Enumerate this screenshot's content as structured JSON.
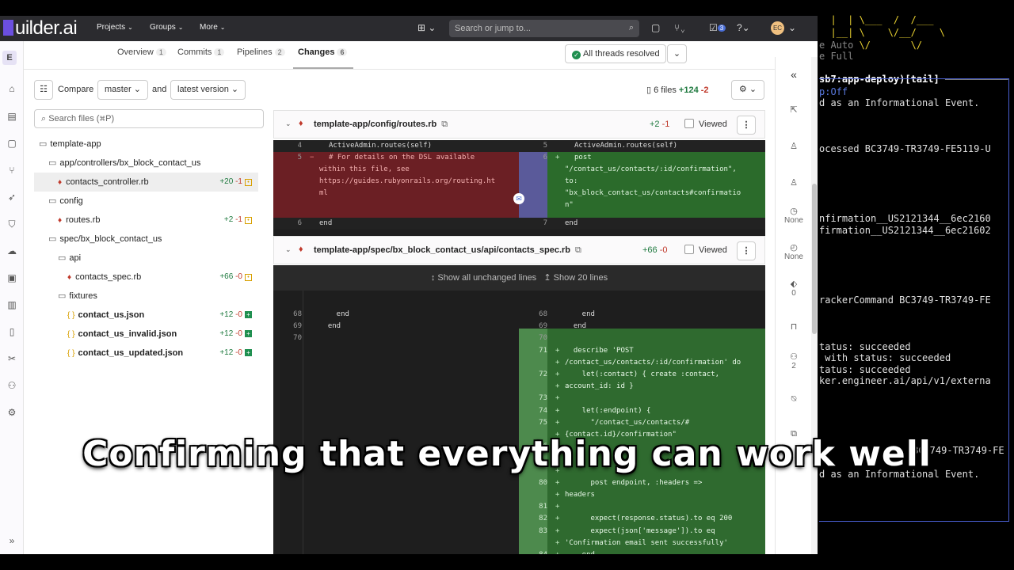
{
  "header": {
    "logo": "uilder.ai",
    "nav": [
      "Projects",
      "Groups",
      "More"
    ],
    "search_placeholder": "Search or jump to...",
    "todo_count": "3",
    "avatar_initials": "EC"
  },
  "tabs": [
    {
      "label": "Overview",
      "count": "1"
    },
    {
      "label": "Commits",
      "count": "1"
    },
    {
      "label": "Pipelines",
      "count": "2"
    },
    {
      "label": "Changes",
      "count": "6"
    }
  ],
  "threads_resolved": "All threads resolved",
  "compare": {
    "label": "Compare",
    "source": "master",
    "and": "and",
    "target": "latest version"
  },
  "summary": {
    "files": "6 files",
    "added": "+124",
    "removed": "-2"
  },
  "file_search_placeholder": "Search files (⌘P)",
  "tree": [
    {
      "label": "template-app"
    },
    {
      "label": "app/controllers/bx_block_contact_us"
    },
    {
      "label": "contacts_controller.rb",
      "add": "+20",
      "del": "-1"
    },
    {
      "label": "config"
    },
    {
      "label": "routes.rb",
      "add": "+2",
      "del": "-1"
    },
    {
      "label": "spec/bx_block_contact_us"
    },
    {
      "label": "api"
    },
    {
      "label": "contacts_spec.rb",
      "add": "+66",
      "del": "-0"
    },
    {
      "label": "fixtures"
    },
    {
      "label": "contact_us.json",
      "add": "+12",
      "del": "-0"
    },
    {
      "label": "contact_us_invalid.json",
      "add": "+12",
      "del": "-0"
    },
    {
      "label": "contact_us_updated.json",
      "add": "+12",
      "del": "-0"
    }
  ],
  "file1": {
    "path": "template-app/config/routes.rb",
    "add": "+2",
    "del": "-1",
    "viewed": "Viewed",
    "lines": {
      "l4": "4",
      "l4c": "ActiveAdmin.routes(self)",
      "r5": "5",
      "r5c": "ActiveAdmin.routes(self)",
      "l5": "5",
      "l5c1": "# For details on the DSL available",
      "l5c2": "within this file, see",
      "l5c3": "https://guides.rubyonrails.org/routing.ht",
      "l5c4": "ml",
      "r6": "6",
      "r6c1": "post",
      "r6c2": "\"/contact_us/contacts/:id/confirmation\",",
      "r6c3": "to:",
      "r6c4": "\"bx_block_contact_us/contacts#confirmatio",
      "r6c5": "n\"",
      "l6": "6",
      "l6c": "end",
      "r7": "7",
      "r7c": "end"
    }
  },
  "file2": {
    "path": "template-app/spec/bx_block_contact_us/api/contacts_spec.rb",
    "add": "+66",
    "del": "-0",
    "viewed": "Viewed",
    "expand_all": "↕ Show all unchanged lines",
    "expand_20": "↥ Show 20 lines",
    "left": [
      {
        "n": "68",
        "c": "    end"
      },
      {
        "n": "69",
        "c": "  end"
      },
      {
        "n": "70",
        "c": ""
      }
    ],
    "right": [
      {
        "n": "68",
        "c": "    end"
      },
      {
        "n": "69",
        "c": "  end"
      },
      {
        "n": "70",
        "c": ""
      },
      {
        "n": "71",
        "c": "  describe 'POST"
      },
      {
        "n": "",
        "c": "/contact_us/contacts/:id/confirmation' do"
      },
      {
        "n": "72",
        "c": "    let(:contact) { create :contact,"
      },
      {
        "n": "",
        "c": "account_id: id }"
      },
      {
        "n": "73",
        "c": ""
      },
      {
        "n": "74",
        "c": "    let(:endpoint) {"
      },
      {
        "n": "75",
        "c": "      \"/contact_us/contacts/#"
      },
      {
        "n": "",
        "c": "{contact.id}/confirmation\""
      },
      {
        "n": "76",
        "c": "    }"
      },
      {
        "n": "",
        "c": ""
      },
      {
        "n": "",
        "c": ""
      },
      {
        "n": "80",
        "c": "      post endpoint, :headers =>"
      },
      {
        "n": "",
        "c": "headers"
      },
      {
        "n": "81",
        "c": ""
      },
      {
        "n": "82",
        "c": "      expect(response.status).to eq 200"
      },
      {
        "n": "83",
        "c": "      expect(json['message']).to eq"
      },
      {
        "n": "",
        "c": "'Confirmation email sent successfully'"
      },
      {
        "n": "84",
        "c": "    end"
      }
    ]
  },
  "right_panel": {
    "time1": "None",
    "time2": "None",
    "labels": "0",
    "participants": "2"
  },
  "terminal": {
    "lines": [
      "e Auto",
      "e Full",
      "sb7:app-deploy)[tail]",
      "p:Off",
      "d as an Informational Event.",
      "ocessed BC3749-TR3749-FE5119-U",
      "nfirmation__US2121344__6ec2160",
      "firmation__US2121344__6ec21602",
      "rackerCommand BC3749-TR3749-FE",
      "tatus: succeeded",
      " with status: succeeded",
      "tatus: succeeded",
      "ker.engineer.ai/api/v1/externa",
      "BC3749-TR3749-FE",
      "d as an Informational Event."
    ]
  },
  "caption": "Confirming that everything can work well"
}
